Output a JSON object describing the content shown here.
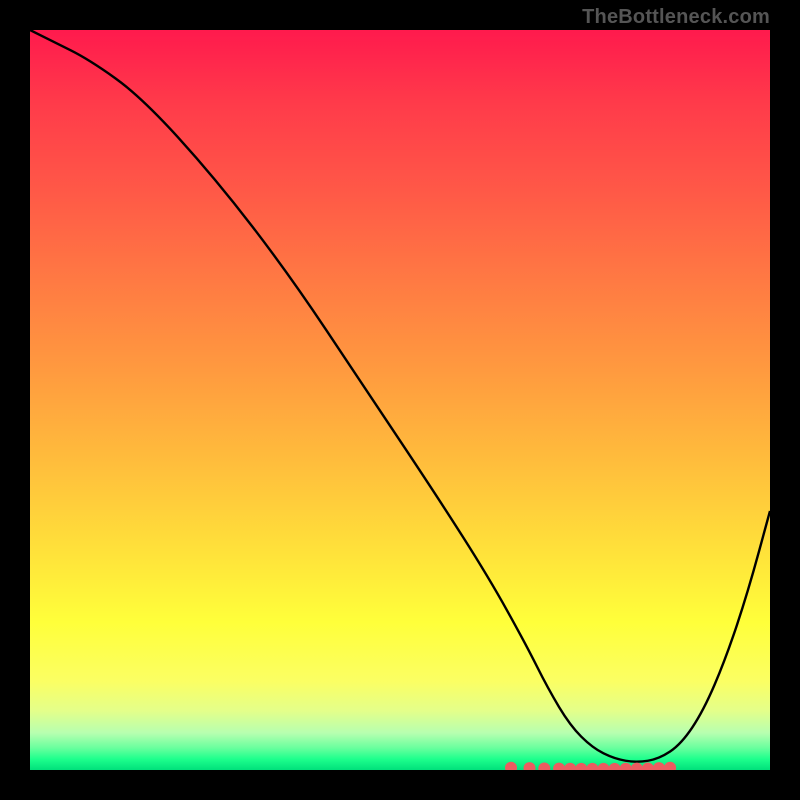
{
  "watermark": "TheBottleneck.com",
  "chart_data": {
    "type": "line",
    "title": "",
    "xlabel": "",
    "ylabel": "",
    "xlim": [
      0,
      100
    ],
    "ylim": [
      0,
      100
    ],
    "grid": false,
    "legend": null,
    "x": [
      0,
      3,
      8,
      15,
      25,
      35,
      45,
      55,
      62,
      67,
      70,
      73,
      76,
      79,
      82,
      85,
      88,
      91,
      94,
      97,
      100
    ],
    "values": [
      100,
      98.5,
      96,
      91,
      80,
      67,
      52,
      37,
      26,
      17,
      11,
      6,
      3,
      1.5,
      1,
      1.5,
      3.5,
      8,
      15,
      24,
      35
    ],
    "markers": {
      "x": [
        65,
        67.5,
        69.5,
        71.5,
        73,
        74.5,
        76,
        77.5,
        79,
        80.5,
        82,
        83.5,
        85,
        86.5
      ],
      "y": [
        0.3,
        0.25,
        0.2,
        0.18,
        0.17,
        0.16,
        0.15,
        0.15,
        0.16,
        0.17,
        0.18,
        0.2,
        0.25,
        0.3
      ],
      "color": "#ec5b60"
    },
    "background_gradient": {
      "top": "#ff1a4d",
      "mid": "#ffe03a",
      "bottom": "#00e07b"
    }
  }
}
